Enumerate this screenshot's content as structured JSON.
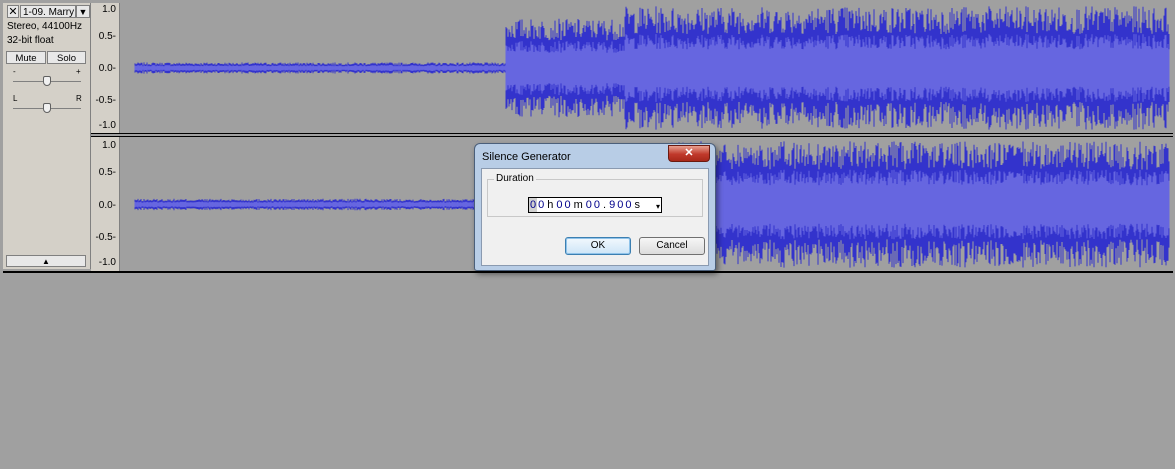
{
  "track": {
    "close_glyph": "✕",
    "name": "1-09. Marry",
    "menu_arrow": "▼",
    "format": "Stereo, 44100Hz",
    "bit_depth": "32-bit float",
    "mute_label": "Mute",
    "solo_label": "Solo",
    "gain_minus": "-",
    "gain_plus": "+",
    "pan_left": "L",
    "pan_right": "R",
    "collapse_glyph": "▲"
  },
  "ruler": {
    "labels": [
      "1.0",
      "0.5-",
      "0.0-",
      "-0.5-",
      "-1.0"
    ]
  },
  "dialog": {
    "title": "Silence Generator",
    "close_glyph": "✕",
    "group_label": "Duration",
    "time": {
      "hh": [
        "0",
        "0"
      ],
      "h_unit": "h",
      "mm": [
        "0",
        "0"
      ],
      "m_unit": "m",
      "ss": [
        "0",
        "0"
      ],
      "dot": ".",
      "ms": [
        "9",
        "0",
        "0"
      ],
      "s_unit": "s",
      "dropdown_glyph": "▾"
    },
    "ok_label": "OK",
    "cancel_label": "Cancel"
  },
  "colors": {
    "waveform": "#3333cc",
    "waveform_light": "#6666e0",
    "background": "#a0a0a0",
    "panel": "#d4d0c8"
  }
}
